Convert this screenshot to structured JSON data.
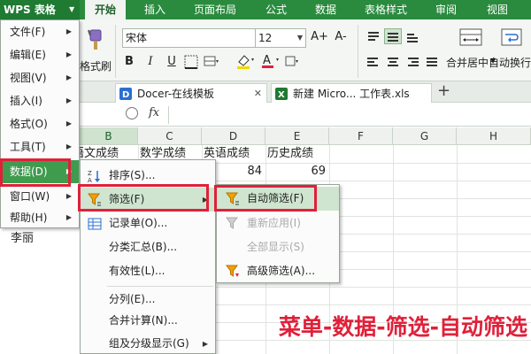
{
  "app": {
    "name": "WPS 表格"
  },
  "tabs": [
    {
      "label": "开始",
      "active": true
    },
    {
      "label": "插入"
    },
    {
      "label": "页面布局"
    },
    {
      "label": "公式"
    },
    {
      "label": "数据"
    },
    {
      "label": "表格样式"
    },
    {
      "label": "审阅"
    },
    {
      "label": "视图"
    }
  ],
  "ribbon": {
    "format_painter_label": "格式刷",
    "font_name": "宋体",
    "font_size": "12",
    "grow_font": "A+",
    "shrink_font": "A-",
    "bold": "B",
    "italic": "I",
    "underline": "U",
    "merge_center_label": "合并居中",
    "wrap_text_label": "自动换行"
  },
  "doc_tabs": [
    {
      "label": "Docer-在线模板"
    },
    {
      "label": "新建 Micro... 工作表.xls"
    }
  ],
  "formula_bar": {
    "fx": "fx"
  },
  "grid": {
    "columns": [
      "B",
      "C",
      "D",
      "E",
      "F",
      "G",
      "H"
    ],
    "selected_column": "B",
    "header_row": [
      "语文成绩",
      "数学成绩",
      "英语成绩",
      "历史成绩"
    ],
    "row2": {
      "D": "84",
      "E": "69"
    },
    "row3_partial": {
      "D": "--",
      "E": "--"
    },
    "name_cell": "李丽"
  },
  "app_menu": {
    "items": [
      {
        "label": "文件(F)",
        "has_sub": true
      },
      {
        "label": "编辑(E)",
        "has_sub": true
      },
      {
        "label": "视图(V)",
        "has_sub": true
      },
      {
        "label": "插入(I)",
        "has_sub": true
      },
      {
        "label": "格式(O)",
        "has_sub": true
      },
      {
        "label": "工具(T)",
        "has_sub": true
      },
      {
        "label": "数据(D)",
        "has_sub": true,
        "active": true
      },
      {
        "label": "窗口(W)",
        "has_sub": true
      },
      {
        "label": "帮助(H)",
        "has_sub": true
      }
    ]
  },
  "data_menu": {
    "items": [
      {
        "label": "排序(S)...",
        "icon": "sort-icon"
      },
      {
        "label": "筛选(F)",
        "icon": "filter-icon",
        "has_sub": true,
        "active": true
      },
      {
        "label": "记录单(O)...",
        "icon": "form-icon"
      },
      {
        "label": "分类汇总(B)..."
      },
      {
        "label": "有效性(L)..."
      },
      {
        "label": "分列(E)..."
      },
      {
        "label": "合并计算(N)..."
      },
      {
        "label": "组及分级显示(G)",
        "has_sub": true
      }
    ]
  },
  "filter_menu": {
    "items": [
      {
        "label": "自动筛选(F)",
        "icon": "filter-icon",
        "active": true
      },
      {
        "label": "重新应用(I)",
        "icon": "reapply-filter-icon",
        "disabled": true
      },
      {
        "label": "全部显示(S)",
        "disabled": true
      },
      {
        "label": "高级筛选(A)...",
        "icon": "advanced-filter-icon"
      }
    ]
  },
  "caption": "菜单-数据-筛选-自动筛选",
  "colors": {
    "brand_green": "#2a8b3e",
    "highlight_red": "#e0203a",
    "menu_active": "#3f9b4e"
  }
}
